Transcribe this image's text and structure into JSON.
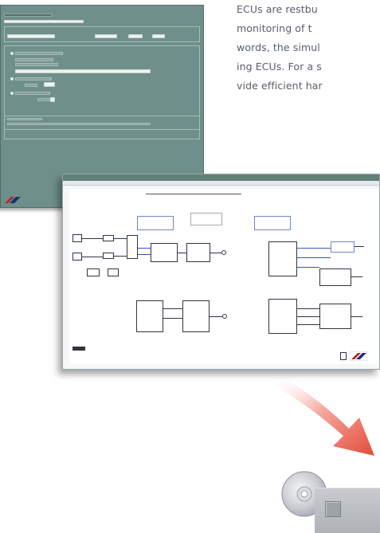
{
  "paragraph": {
    "lines": [
      "ECUs are restbu",
      "monitoring of t",
      "words, the simul",
      "ing ECUs. For a s",
      "vide efficient har"
    ]
  },
  "colors": {
    "text": "#555f6b",
    "dialog_bg": "#6f8f8a",
    "model_titlebar": "#5f8076",
    "accent_blue": "#3d54b8",
    "arrow_red": "#e34b3a"
  },
  "icons": {
    "logo": "dspace-logo",
    "cd": "cd-disc-icon",
    "drive": "drive-unit"
  }
}
